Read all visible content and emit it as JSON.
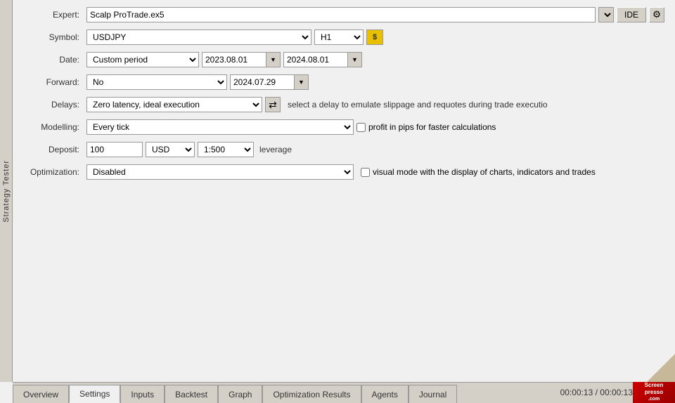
{
  "app": {
    "side_label": "Strategy Tester"
  },
  "form": {
    "expert_label": "Expert:",
    "expert_value": "Scalp ProTrade.ex5",
    "ide_label": "IDE",
    "symbol_label": "Symbol:",
    "symbol_value": "USDJPY",
    "timeframe_value": "H1",
    "date_label": "Date:",
    "date_period": "Custom period",
    "date_from": "2023.08.01",
    "date_to": "2024.08.01",
    "forward_label": "Forward:",
    "forward_value": "No",
    "forward_date": "2024.07.29",
    "delays_label": "Delays:",
    "delays_value": "Zero latency, ideal execution",
    "delays_info": "select a delay to emulate slippage and requotes during trade executio",
    "modelling_label": "Modelling:",
    "modelling_value": "Every tick",
    "profit_pips_label": "profit in pips for faster calculations",
    "deposit_label": "Deposit:",
    "deposit_value": "100",
    "currency_value": "USD",
    "leverage_value": "1:500",
    "leverage_label": "leverage",
    "optimization_label": "Optimization:",
    "optimization_value": "Disabled",
    "visual_mode_label": "visual mode with the display of charts, indicators and trades"
  },
  "tabs": [
    {
      "id": "overview",
      "label": "Overview",
      "active": false
    },
    {
      "id": "settings",
      "label": "Settings",
      "active": true
    },
    {
      "id": "inputs",
      "label": "Inputs",
      "active": false
    },
    {
      "id": "backtest",
      "label": "Backtest",
      "active": false
    },
    {
      "id": "graph",
      "label": "Graph",
      "active": false
    },
    {
      "id": "optimization-results",
      "label": "Optimization Results",
      "active": false
    },
    {
      "id": "agents",
      "label": "Agents",
      "active": false
    },
    {
      "id": "journal",
      "label": "Journal",
      "active": false
    }
  ],
  "status": {
    "timer": "00:00:13 / 00:00:13"
  },
  "icons": {
    "gear": "⚙",
    "calendar": "▼",
    "transfer": "⇄",
    "dollar": "$",
    "close": "✕"
  }
}
